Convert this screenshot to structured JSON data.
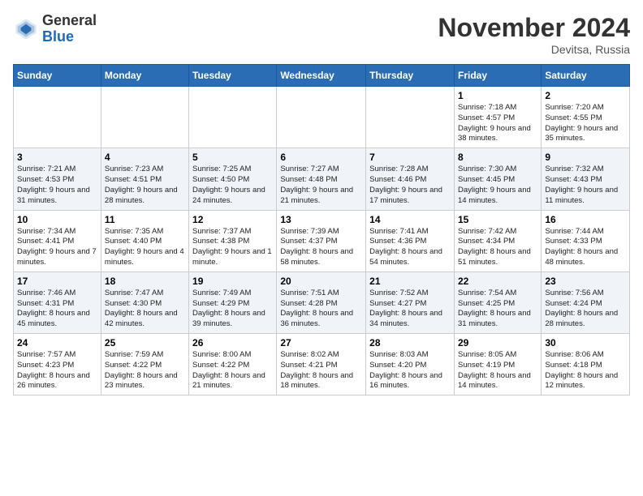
{
  "header": {
    "logo_general": "General",
    "logo_blue": "Blue",
    "month_title": "November 2024",
    "location": "Devitsa, Russia"
  },
  "columns": [
    "Sunday",
    "Monday",
    "Tuesday",
    "Wednesday",
    "Thursday",
    "Friday",
    "Saturday"
  ],
  "weeks": [
    [
      {
        "day": "",
        "info": ""
      },
      {
        "day": "",
        "info": ""
      },
      {
        "day": "",
        "info": ""
      },
      {
        "day": "",
        "info": ""
      },
      {
        "day": "",
        "info": ""
      },
      {
        "day": "1",
        "info": "Sunrise: 7:18 AM\nSunset: 4:57 PM\nDaylight: 9 hours\nand 38 minutes."
      },
      {
        "day": "2",
        "info": "Sunrise: 7:20 AM\nSunset: 4:55 PM\nDaylight: 9 hours\nand 35 minutes."
      }
    ],
    [
      {
        "day": "3",
        "info": "Sunrise: 7:21 AM\nSunset: 4:53 PM\nDaylight: 9 hours\nand 31 minutes."
      },
      {
        "day": "4",
        "info": "Sunrise: 7:23 AM\nSunset: 4:51 PM\nDaylight: 9 hours\nand 28 minutes."
      },
      {
        "day": "5",
        "info": "Sunrise: 7:25 AM\nSunset: 4:50 PM\nDaylight: 9 hours\nand 24 minutes."
      },
      {
        "day": "6",
        "info": "Sunrise: 7:27 AM\nSunset: 4:48 PM\nDaylight: 9 hours\nand 21 minutes."
      },
      {
        "day": "7",
        "info": "Sunrise: 7:28 AM\nSunset: 4:46 PM\nDaylight: 9 hours\nand 17 minutes."
      },
      {
        "day": "8",
        "info": "Sunrise: 7:30 AM\nSunset: 4:45 PM\nDaylight: 9 hours\nand 14 minutes."
      },
      {
        "day": "9",
        "info": "Sunrise: 7:32 AM\nSunset: 4:43 PM\nDaylight: 9 hours\nand 11 minutes."
      }
    ],
    [
      {
        "day": "10",
        "info": "Sunrise: 7:34 AM\nSunset: 4:41 PM\nDaylight: 9 hours\nand 7 minutes."
      },
      {
        "day": "11",
        "info": "Sunrise: 7:35 AM\nSunset: 4:40 PM\nDaylight: 9 hours\nand 4 minutes."
      },
      {
        "day": "12",
        "info": "Sunrise: 7:37 AM\nSunset: 4:38 PM\nDaylight: 9 hours\nand 1 minute."
      },
      {
        "day": "13",
        "info": "Sunrise: 7:39 AM\nSunset: 4:37 PM\nDaylight: 8 hours\nand 58 minutes."
      },
      {
        "day": "14",
        "info": "Sunrise: 7:41 AM\nSunset: 4:36 PM\nDaylight: 8 hours\nand 54 minutes."
      },
      {
        "day": "15",
        "info": "Sunrise: 7:42 AM\nSunset: 4:34 PM\nDaylight: 8 hours\nand 51 minutes."
      },
      {
        "day": "16",
        "info": "Sunrise: 7:44 AM\nSunset: 4:33 PM\nDaylight: 8 hours\nand 48 minutes."
      }
    ],
    [
      {
        "day": "17",
        "info": "Sunrise: 7:46 AM\nSunset: 4:31 PM\nDaylight: 8 hours\nand 45 minutes."
      },
      {
        "day": "18",
        "info": "Sunrise: 7:47 AM\nSunset: 4:30 PM\nDaylight: 8 hours\nand 42 minutes."
      },
      {
        "day": "19",
        "info": "Sunrise: 7:49 AM\nSunset: 4:29 PM\nDaylight: 8 hours\nand 39 minutes."
      },
      {
        "day": "20",
        "info": "Sunrise: 7:51 AM\nSunset: 4:28 PM\nDaylight: 8 hours\nand 36 minutes."
      },
      {
        "day": "21",
        "info": "Sunrise: 7:52 AM\nSunset: 4:27 PM\nDaylight: 8 hours\nand 34 minutes."
      },
      {
        "day": "22",
        "info": "Sunrise: 7:54 AM\nSunset: 4:25 PM\nDaylight: 8 hours\nand 31 minutes."
      },
      {
        "day": "23",
        "info": "Sunrise: 7:56 AM\nSunset: 4:24 PM\nDaylight: 8 hours\nand 28 minutes."
      }
    ],
    [
      {
        "day": "24",
        "info": "Sunrise: 7:57 AM\nSunset: 4:23 PM\nDaylight: 8 hours\nand 26 minutes."
      },
      {
        "day": "25",
        "info": "Sunrise: 7:59 AM\nSunset: 4:22 PM\nDaylight: 8 hours\nand 23 minutes."
      },
      {
        "day": "26",
        "info": "Sunrise: 8:00 AM\nSunset: 4:22 PM\nDaylight: 8 hours\nand 21 minutes."
      },
      {
        "day": "27",
        "info": "Sunrise: 8:02 AM\nSunset: 4:21 PM\nDaylight: 8 hours\nand 18 minutes."
      },
      {
        "day": "28",
        "info": "Sunrise: 8:03 AM\nSunset: 4:20 PM\nDaylight: 8 hours\nand 16 minutes."
      },
      {
        "day": "29",
        "info": "Sunrise: 8:05 AM\nSunset: 4:19 PM\nDaylight: 8 hours\nand 14 minutes."
      },
      {
        "day": "30",
        "info": "Sunrise: 8:06 AM\nSunset: 4:18 PM\nDaylight: 8 hours\nand 12 minutes."
      }
    ]
  ]
}
